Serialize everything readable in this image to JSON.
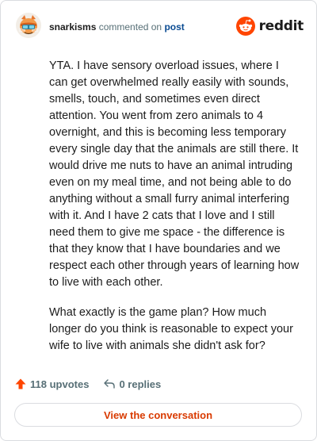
{
  "header": {
    "username": "snarkisms",
    "commented_text": "commented on",
    "post_link": "post",
    "brand": "reddit"
  },
  "comment": {
    "paragraphs": [
      "YTA. I have sensory overload issues, where I can get overwhelmed really easily with sounds, smells, touch, and sometimes even direct attention. You went from zero animals to 4 overnight, and this is becoming less temporary every single day that the animals are still there. It would drive me nuts to have an animal intruding even on my meal time, and not being able to do anything without a small furry animal interfering with it. And I have 2 cats that I love and I still need them to give me space - the difference is that they know that I have boundaries and we respect each other through years of learning how to live with each other.",
      "What exactly is the game plan? How much longer do you think is reasonable to expect your wife to live with animals she didn't ask for?"
    ]
  },
  "actions": {
    "upvotes": "118 upvotes",
    "replies": "0 replies"
  },
  "view_button": "View the conversation",
  "colors": {
    "accent": "#d93a00",
    "brand": "#ff4500",
    "link": "#0a4b92",
    "muted": "#576f76"
  }
}
